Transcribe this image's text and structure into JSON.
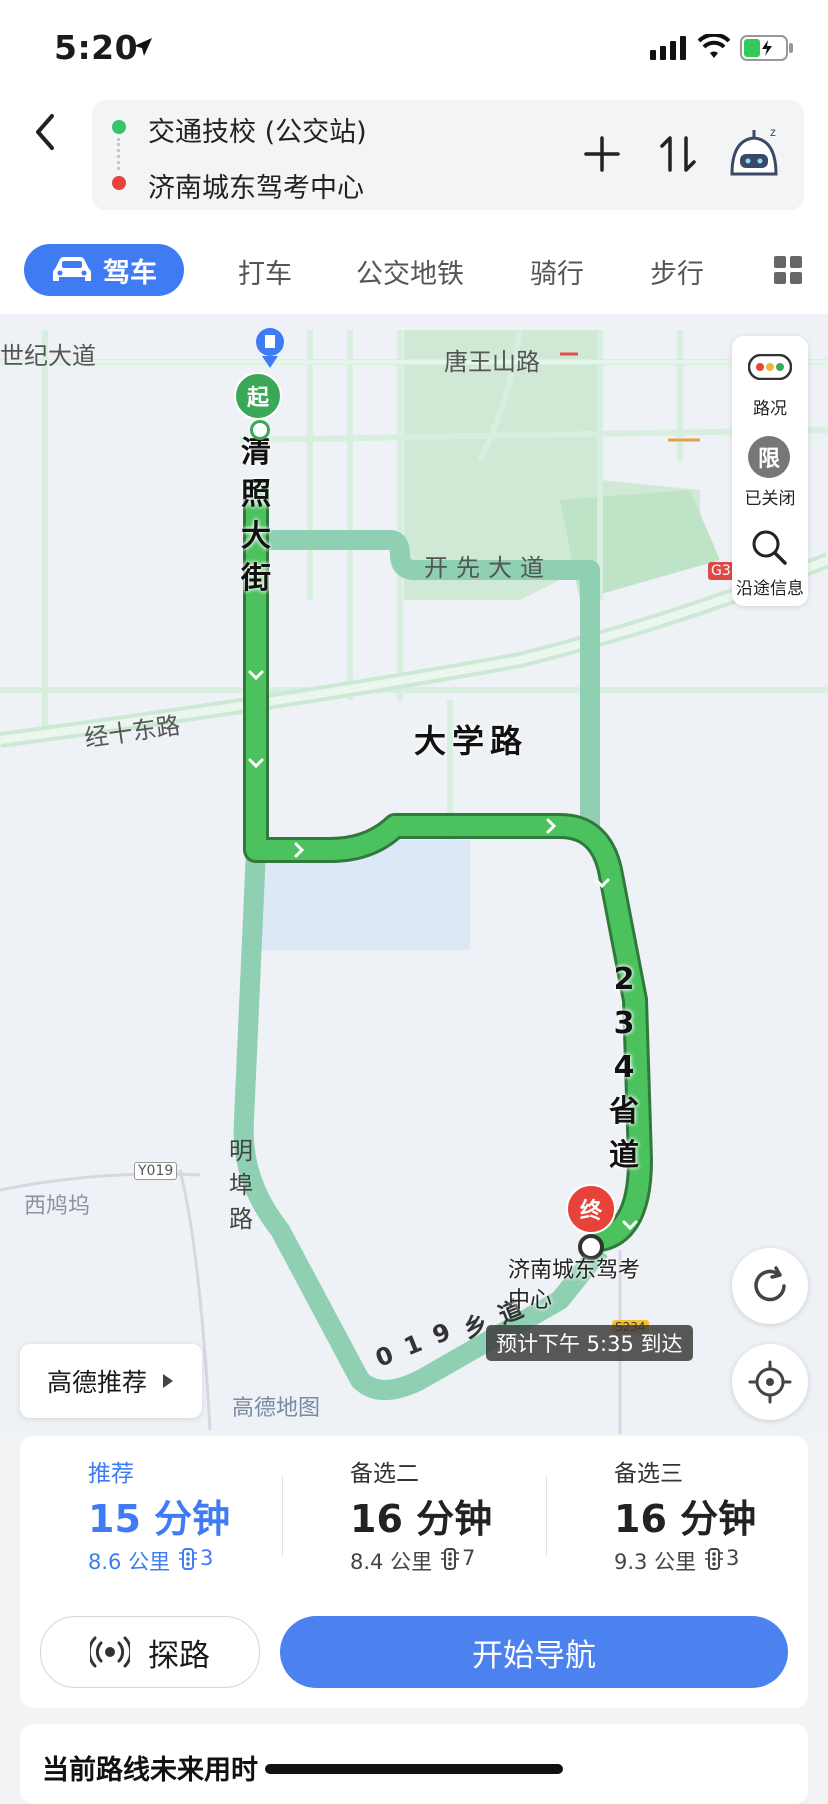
{
  "status_bar": {
    "time": "5:20"
  },
  "header": {
    "origin": "交通技校 (公交站)",
    "destination": "济南城东驾考中心",
    "origin_color": "#35c36b",
    "destination_color": "#e8423a"
  },
  "tabs": {
    "items": [
      "驾车",
      "打车",
      "公交地铁",
      "骑行",
      "步行"
    ],
    "active": "驾车"
  },
  "map": {
    "labels": {
      "century_ave": "世纪大道",
      "tangwangshan": "唐王山路",
      "kaixian": "开先大道",
      "jingshi": "经十东路",
      "xihuwu": "西鸠坞",
      "y019": "Y019",
      "s234": "S234",
      "g3": "G3",
      "watermark": "高德地图"
    },
    "route_labels": {
      "qingzhao": [
        "清",
        "照",
        "大",
        "街"
      ],
      "daxue": "大学路",
      "s234_road": [
        "2",
        "3",
        "4",
        "省",
        "道"
      ],
      "minghan": [
        "明",
        "埠",
        "路"
      ],
      "x019": [
        "0",
        "1",
        "9",
        "乡",
        "道"
      ]
    },
    "start_marker": "起",
    "end_marker": "终",
    "dest_label": [
      "济南城东驾考",
      "中心"
    ],
    "eta": "预计下午 5:35 到达",
    "route_color": "#4cc25f",
    "alt_route_color": "#8fcfb2"
  },
  "side_panel": {
    "traffic": "路况",
    "restrict_icon_text": "限",
    "restrict": "已关闭",
    "along": "沿途信息"
  },
  "recommend_button": "高德推荐",
  "routes": [
    {
      "tag": "推荐",
      "time": "15 分钟",
      "dist": "8.6 公里",
      "lights": "3",
      "highlight": true
    },
    {
      "tag": "备选二",
      "time": "16 分钟",
      "dist": "8.4 公里",
      "lights": "7",
      "highlight": false
    },
    {
      "tag": "备选三",
      "time": "16 分钟",
      "dist": "9.3 公里",
      "lights": "3",
      "highlight": false
    }
  ],
  "probe_button": "探路",
  "start_nav_button": "开始导航",
  "future_note": "当前路线未来用时"
}
